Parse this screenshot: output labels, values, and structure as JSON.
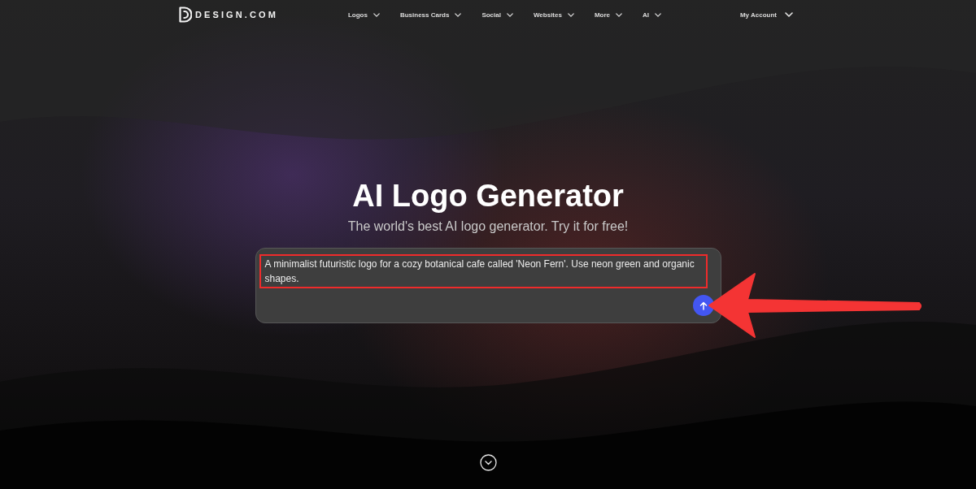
{
  "header": {
    "logo_text": "DESIGN.COM",
    "nav": [
      {
        "label": "Logos"
      },
      {
        "label": "Business Cards"
      },
      {
        "label": "Social"
      },
      {
        "label": "Websites"
      },
      {
        "label": "More"
      },
      {
        "label": "AI"
      }
    ],
    "account": "My Account"
  },
  "hero": {
    "title": "AI Logo Generator",
    "subtitle": "The world's best AI logo generator. Try it for free!"
  },
  "prompt": {
    "value": "A minimalist futuristic logo for a cozy botanical cafe called 'Neon Fern'. Use neon green and organic shapes.",
    "highlighted": true,
    "arrow": true
  }
}
